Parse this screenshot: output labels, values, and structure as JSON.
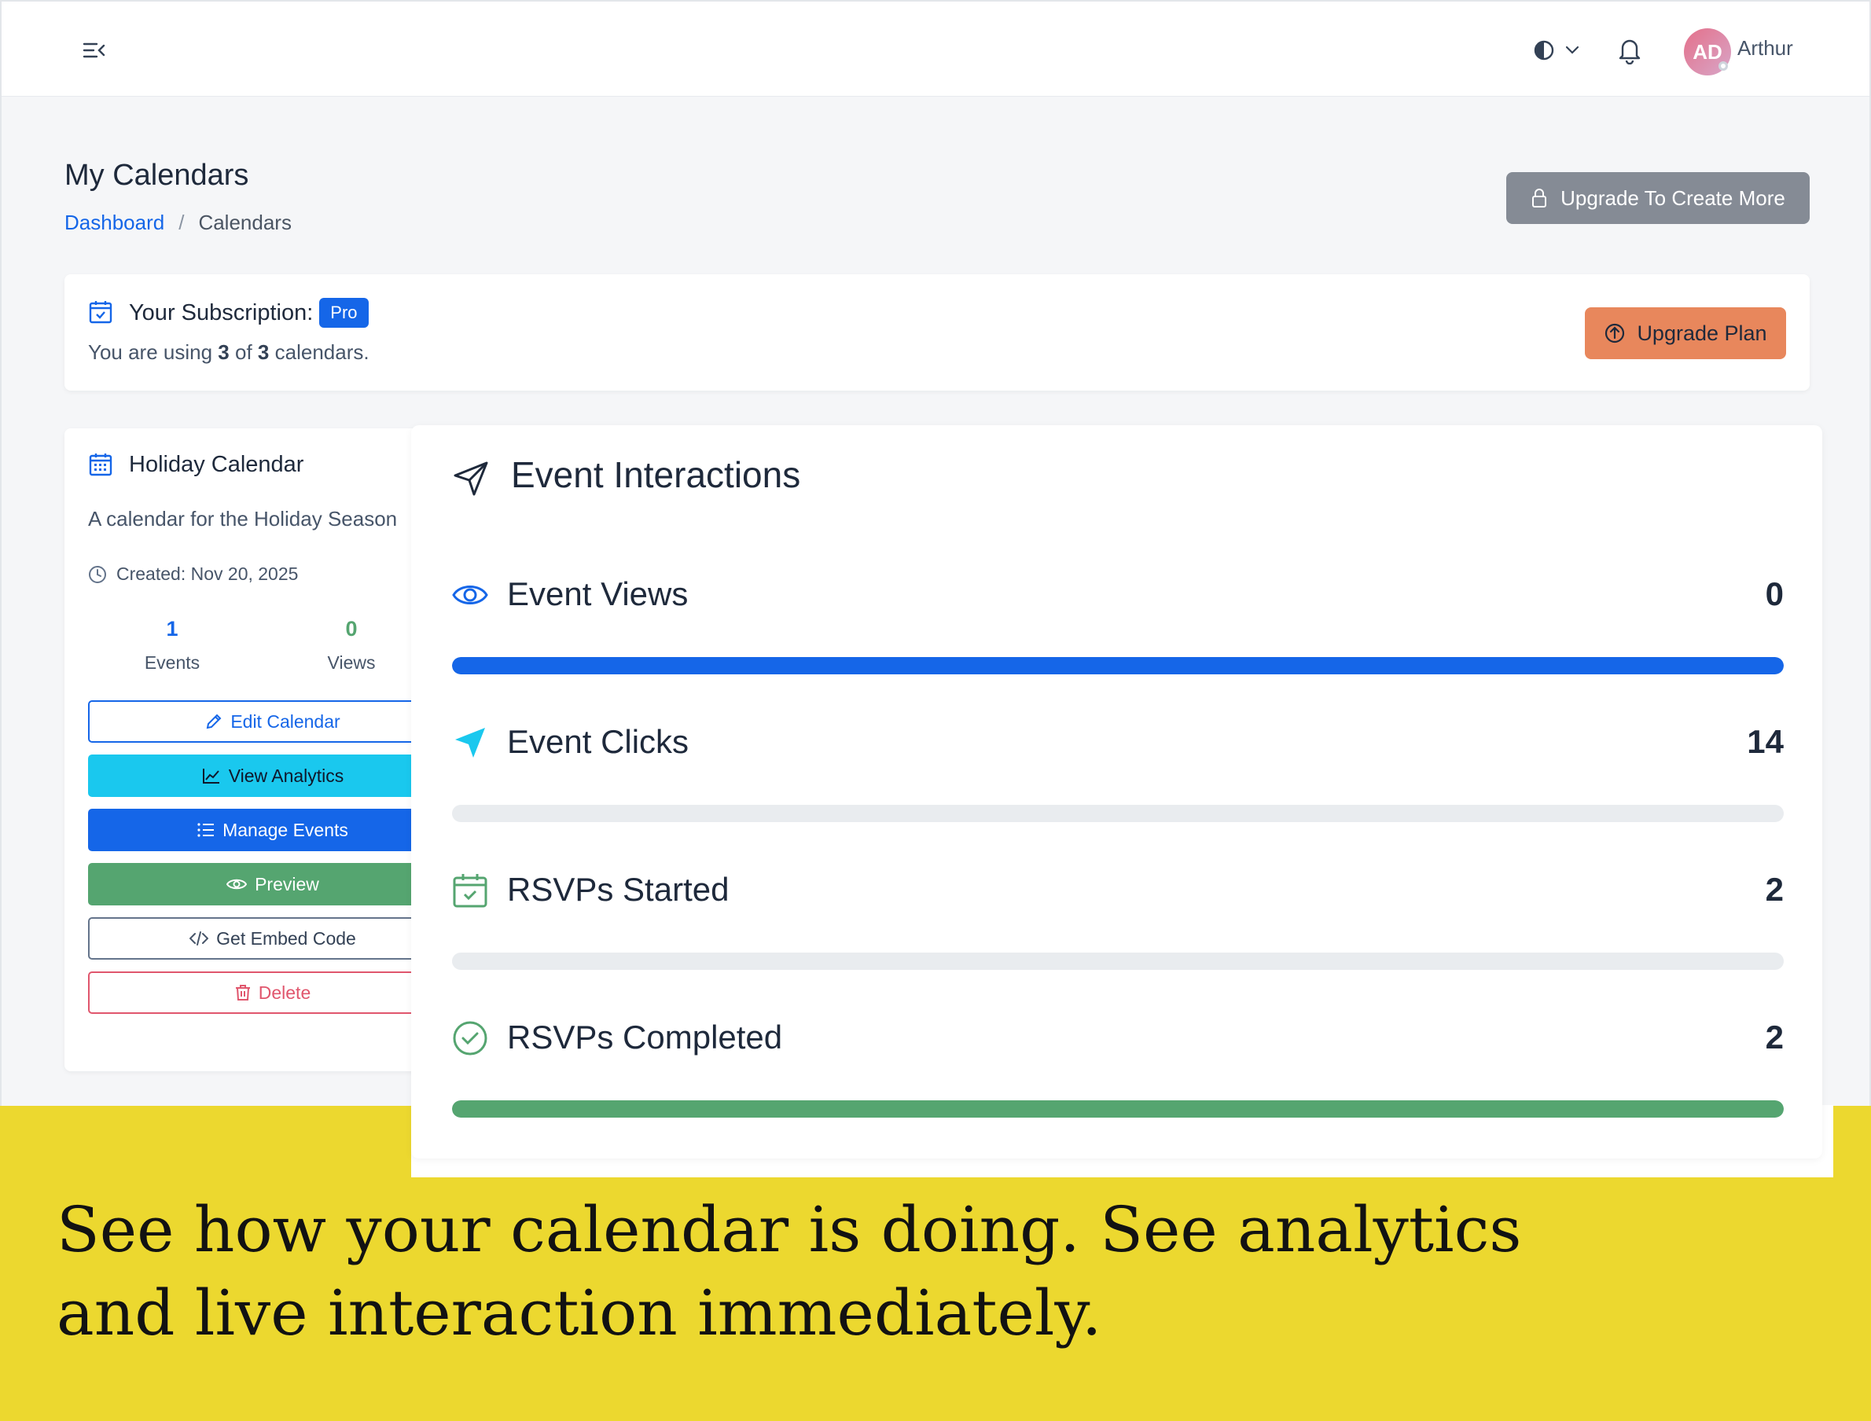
{
  "header": {
    "user_name": "Arthur",
    "avatar_initials": "AD",
    "icons": [
      "menu-collapse-icon",
      "theme-contrast-icon",
      "chevron-down-icon",
      "bell-icon"
    ]
  },
  "page": {
    "title": "My Calendars",
    "breadcrumb": {
      "home": "Dashboard",
      "separator": "/",
      "current": "Calendars"
    },
    "upgrade_more_label": "Upgrade To Create More"
  },
  "subscription": {
    "title": "Your Subscription:",
    "plan": "Pro",
    "usage_prefix": "You are using",
    "used": "3",
    "of": "of",
    "total": "3",
    "usage_suffix": "calendars.",
    "upgrade_label": "Upgrade Plan"
  },
  "calendar": {
    "title": "Holiday Calendar",
    "description": "A calendar for the Holiday Season",
    "created": "Created: Nov 20, 2025",
    "stats": {
      "events_value": "1",
      "events_label": "Events",
      "views_value": "0",
      "views_label": "Views"
    },
    "buttons": {
      "edit": "Edit Calendar",
      "analytics": "View Analytics",
      "manage": "Manage Events",
      "preview": "Preview",
      "embed": "Get Embed Code",
      "delete": "Delete"
    }
  },
  "interactions": {
    "title": "Event Interactions",
    "metrics": [
      {
        "label": "Event Views",
        "value": "0",
        "fill": 1.0
      },
      {
        "label": "Event Clicks",
        "value": "14",
        "fill": 0.0
      },
      {
        "label": "RSVPs Started",
        "value": "2",
        "fill": 0.0
      },
      {
        "label": "RSVPs Completed",
        "value": "2",
        "fill": 1.0
      }
    ]
  },
  "colors": {
    "primary": "#1566e8",
    "cyan": "#1ac8ee",
    "green": "#55a570",
    "danger": "#e0566d",
    "upgrade": "#e8875c",
    "caption_bg": "#ecd82f"
  },
  "caption": {
    "line1": "See how your calendar is doing. See analytics",
    "line2": "and live interaction immediately."
  }
}
